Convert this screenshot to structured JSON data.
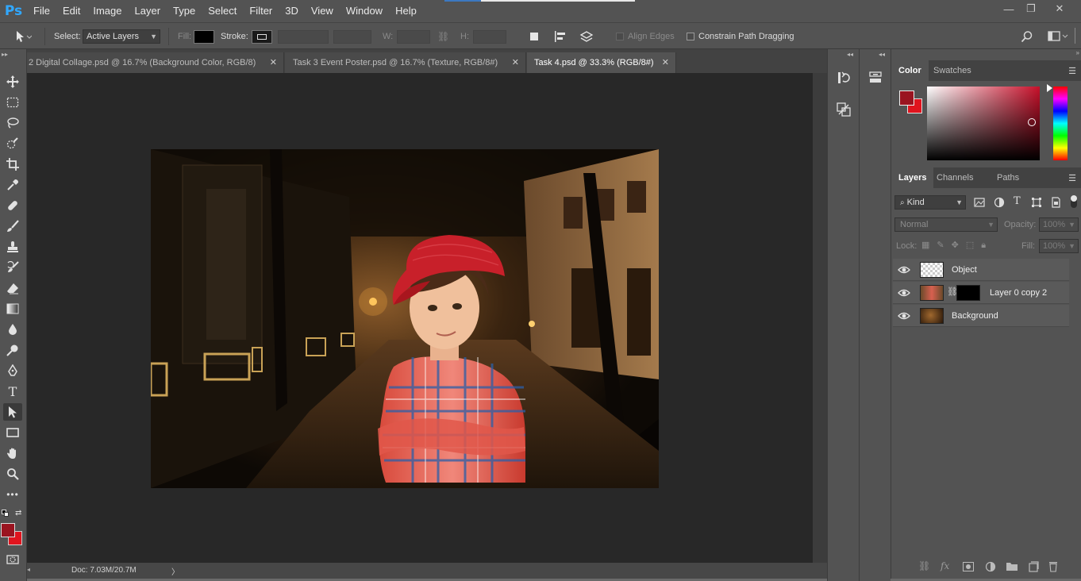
{
  "app": {
    "logo": "Ps"
  },
  "menu": [
    "File",
    "Edit",
    "Image",
    "Layer",
    "Type",
    "Select",
    "Filter",
    "3D",
    "View",
    "Window",
    "Help"
  ],
  "window_controls": {
    "minimize": "—",
    "restore": "❐",
    "close": "✕"
  },
  "options": {
    "select_label": "Select:",
    "select_value": "Active Layers",
    "fill_label": "Fill:",
    "stroke_label": "Stroke:",
    "w_label": "W:",
    "h_label": "H:",
    "align_edges_label": "Align Edges",
    "constrain_label": "Constrain Path Dragging"
  },
  "tabs": [
    {
      "label": "2 Digital Collage.psd @ 16.7% (Background Color, RGB/8)",
      "close": "✕"
    },
    {
      "label": "Task 3 Event Poster.psd @ 16.7% (Texture, RGB/8#)",
      "close": "✕"
    },
    {
      "label": "Task 4.psd @ 33.3% (RGB/8#)",
      "close": "✕"
    }
  ],
  "status": {
    "doc": "Doc: 7.03M/20.7M",
    "arrow": "〉"
  },
  "colors": {
    "foreground": "#9a1420",
    "background": "#e0141e",
    "accent": "#31a8ff"
  },
  "color_panel": {
    "tabs": [
      "Color",
      "Swatches"
    ]
  },
  "layers_panel": {
    "tabs": [
      "Layers",
      "Channels",
      "Paths"
    ],
    "kind_label": "Kind",
    "blend_mode": "Normal",
    "opacity_label": "Opacity:",
    "opacity_value": "100%",
    "lock_label": "Lock:",
    "fill_label": "Fill:",
    "fill_value": "100%",
    "layers": [
      {
        "name": "Object"
      },
      {
        "name": "Layer 0 copy 2"
      },
      {
        "name": "Background"
      }
    ]
  }
}
